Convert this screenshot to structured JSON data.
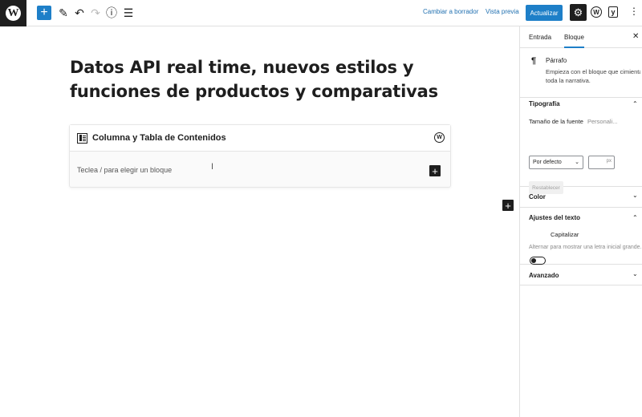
{
  "topbar": {
    "logo_glyph": "W",
    "add_glyph": "+",
    "edit_glyph": "✎",
    "undo_glyph": "↶",
    "redo_glyph": "↷",
    "info_glyph": "ⓘ",
    "list_glyph": "☰",
    "switch_draft": "Cambiar a borrador",
    "preview": "Vista previa",
    "update": "Actualizar",
    "settings_glyph": "⚙",
    "plugin_glyph": "W",
    "yoast_glyph": "y",
    "more_glyph": "⋮"
  },
  "editor": {
    "title": "Datos API real time, nuevos estilos y funciones de productos y comparativas",
    "block": {
      "title": "Columna y Tabla de Contenidos",
      "badge": "W",
      "placeholder": "Teclea / para elegir un bloque",
      "cursor_glyph": "I",
      "add_glyph": "+"
    },
    "side_add_glyph": "+"
  },
  "sidebar": {
    "tabs": [
      "Entrada",
      "Bloque"
    ],
    "close_glyph": "✕",
    "block_card": {
      "icon_glyph": "¶",
      "name": "Párrafo",
      "description_line1": "Empieza con el bloque que cimienta",
      "description_line2": "toda la narrativa."
    },
    "typography": {
      "title": "Tipografía",
      "chev": "⌃",
      "font_size_label": "Tamaño de la fuente",
      "custom_label": "Personali...",
      "select_value": "Por defecto",
      "select_arrow": "⌄",
      "unit": "px",
      "reset": "Restablecer"
    },
    "color": {
      "title": "Color",
      "chev": "⌄"
    },
    "text_settings": {
      "title": "Ajustes del texto",
      "chev": "⌃",
      "toggle_label": "Capitalizar",
      "help": "Alternar para mostrar una letra inicial grande."
    },
    "advanced": {
      "title": "Avanzado",
      "chev": "⌄"
    }
  },
  "colors": {
    "accent": "#1e7fc8",
    "dark": "#1e1e1e",
    "link": "#2271b1"
  }
}
